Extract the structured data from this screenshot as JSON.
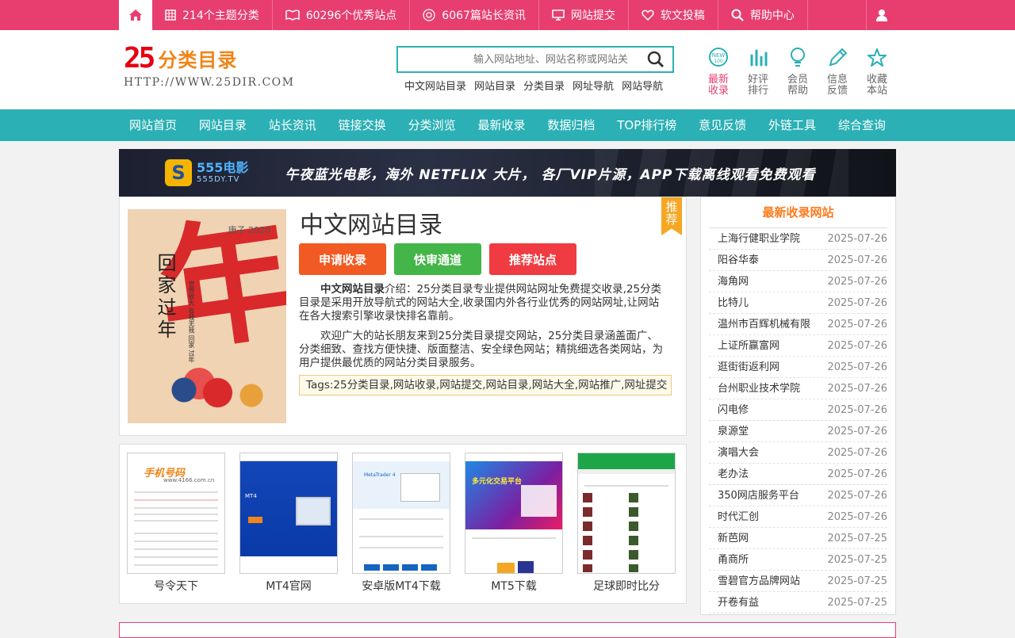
{
  "topbar": {
    "items": [
      {
        "label": "214个主题分类",
        "icon": "grid-icon"
      },
      {
        "label": "60296个优秀站点",
        "icon": "book-icon"
      },
      {
        "label": "6067篇站长资讯",
        "icon": "target-icon"
      },
      {
        "label": "网站提交",
        "icon": "monitor-icon"
      },
      {
        "label": "软文投稿",
        "icon": "heart-icon"
      },
      {
        "label": "帮助中心",
        "icon": "search-icon"
      }
    ]
  },
  "header": {
    "logo_num": "25",
    "logo_text": "分类目录",
    "logo_url": "HTTP://WWW.25DIR.COM",
    "search_placeholder": "输入网站地址、网站名称或网站关",
    "hot_links": [
      "中文网站目录",
      "网站目录",
      "分类目录",
      "网址导航",
      "网站导航"
    ],
    "quick": [
      {
        "l1": "最新",
        "l2": "收录",
        "icon": "new-icon"
      },
      {
        "l1": "好评",
        "l2": "排行",
        "icon": "bar-chart-icon"
      },
      {
        "l1": "会员",
        "l2": "帮助",
        "icon": "lightbulb-icon"
      },
      {
        "l1": "信息",
        "l2": "反馈",
        "icon": "pencil-icon"
      },
      {
        "l1": "收藏",
        "l2": "本站",
        "icon": "star-icon"
      }
    ]
  },
  "nav": [
    "网站首页",
    "网站目录",
    "站长资讯",
    "链接交换",
    "分类浏览",
    "最新收录",
    "数据归档",
    "TOP排行榜",
    "意见反馈",
    "外链工具",
    "综合查询"
  ],
  "banner": {
    "brand": "555电影",
    "brand_sub": "555DY.TV",
    "slogan": "午夜蓝光电影，海外 NETFLIX 大片，   各厂VIP片源，APP下载离线观看免费观看"
  },
  "site": {
    "title": "中文网站目录",
    "ribbon": "推荐",
    "poster": {
      "vertical": "回家过年",
      "big": "年",
      "year": "庚子 2020",
      "small": "世界很大 有我无我 回家 过年"
    },
    "buttons": [
      "申请收录",
      "快审通道",
      "推荐站点"
    ],
    "intro_name": "中文网站目录",
    "intro_p1": "介绍：25分类目录专业提供网站网址免费提交收录,25分类目录是采用开放导航式的网站大全,收录国内外各行业优秀的网站网址,让网站在各大搜索引擎收录快排名靠前。",
    "intro_p2": "欢迎广大的站长朋友来到25分类目录提交网站，25分类目录涵盖面广、分类细致、查找方便快捷、版面整洁、安全绿色网站；精挑细选各类网站，为用户提供最优质的网站分类目录服务。",
    "tags": "Tags:25分类目录,网站收录,网站提交,网站目录,网站大全,网站推广,网址提交"
  },
  "thumbs": [
    {
      "caption": "号令天下",
      "brand": "手机号码",
      "url": "www.4166.com.cn"
    },
    {
      "caption": "MT4官网",
      "brand": "MT4"
    },
    {
      "caption": "安卓版MT4下载",
      "brand": "MetaTrader 4"
    },
    {
      "caption": "MT5下载",
      "brand": "多元化交易平台"
    },
    {
      "caption": "足球即时比分"
    }
  ],
  "recent": {
    "title": "最新收录网站",
    "rows": [
      {
        "name": "上海行健职业学院",
        "date": "2025-07-26"
      },
      {
        "name": "阳谷华泰",
        "date": "2025-07-26"
      },
      {
        "name": "海角网",
        "date": "2025-07-26"
      },
      {
        "name": "比特儿",
        "date": "2025-07-26"
      },
      {
        "name": "温州市百辉机械有限",
        "date": "2025-07-26"
      },
      {
        "name": "上证所赢富网",
        "date": "2025-07-26"
      },
      {
        "name": "逛街街返利网",
        "date": "2025-07-26"
      },
      {
        "name": "台州职业技术学院",
        "date": "2025-07-26"
      },
      {
        "name": "闪电修",
        "date": "2025-07-26"
      },
      {
        "name": "泉源堂",
        "date": "2025-07-26"
      },
      {
        "name": "演唱大会",
        "date": "2025-07-26"
      },
      {
        "name": "老办法",
        "date": "2025-07-26"
      },
      {
        "name": "350网店服务平台",
        "date": "2025-07-26"
      },
      {
        "name": "时代汇创",
        "date": "2025-07-26"
      },
      {
        "name": "新芭网",
        "date": "2025-07-25"
      },
      {
        "name": "甬商所",
        "date": "2025-07-25"
      },
      {
        "name": "雪碧官方品牌网站",
        "date": "2025-07-25"
      },
      {
        "name": "开卷有益",
        "date": "2025-07-25"
      }
    ]
  }
}
